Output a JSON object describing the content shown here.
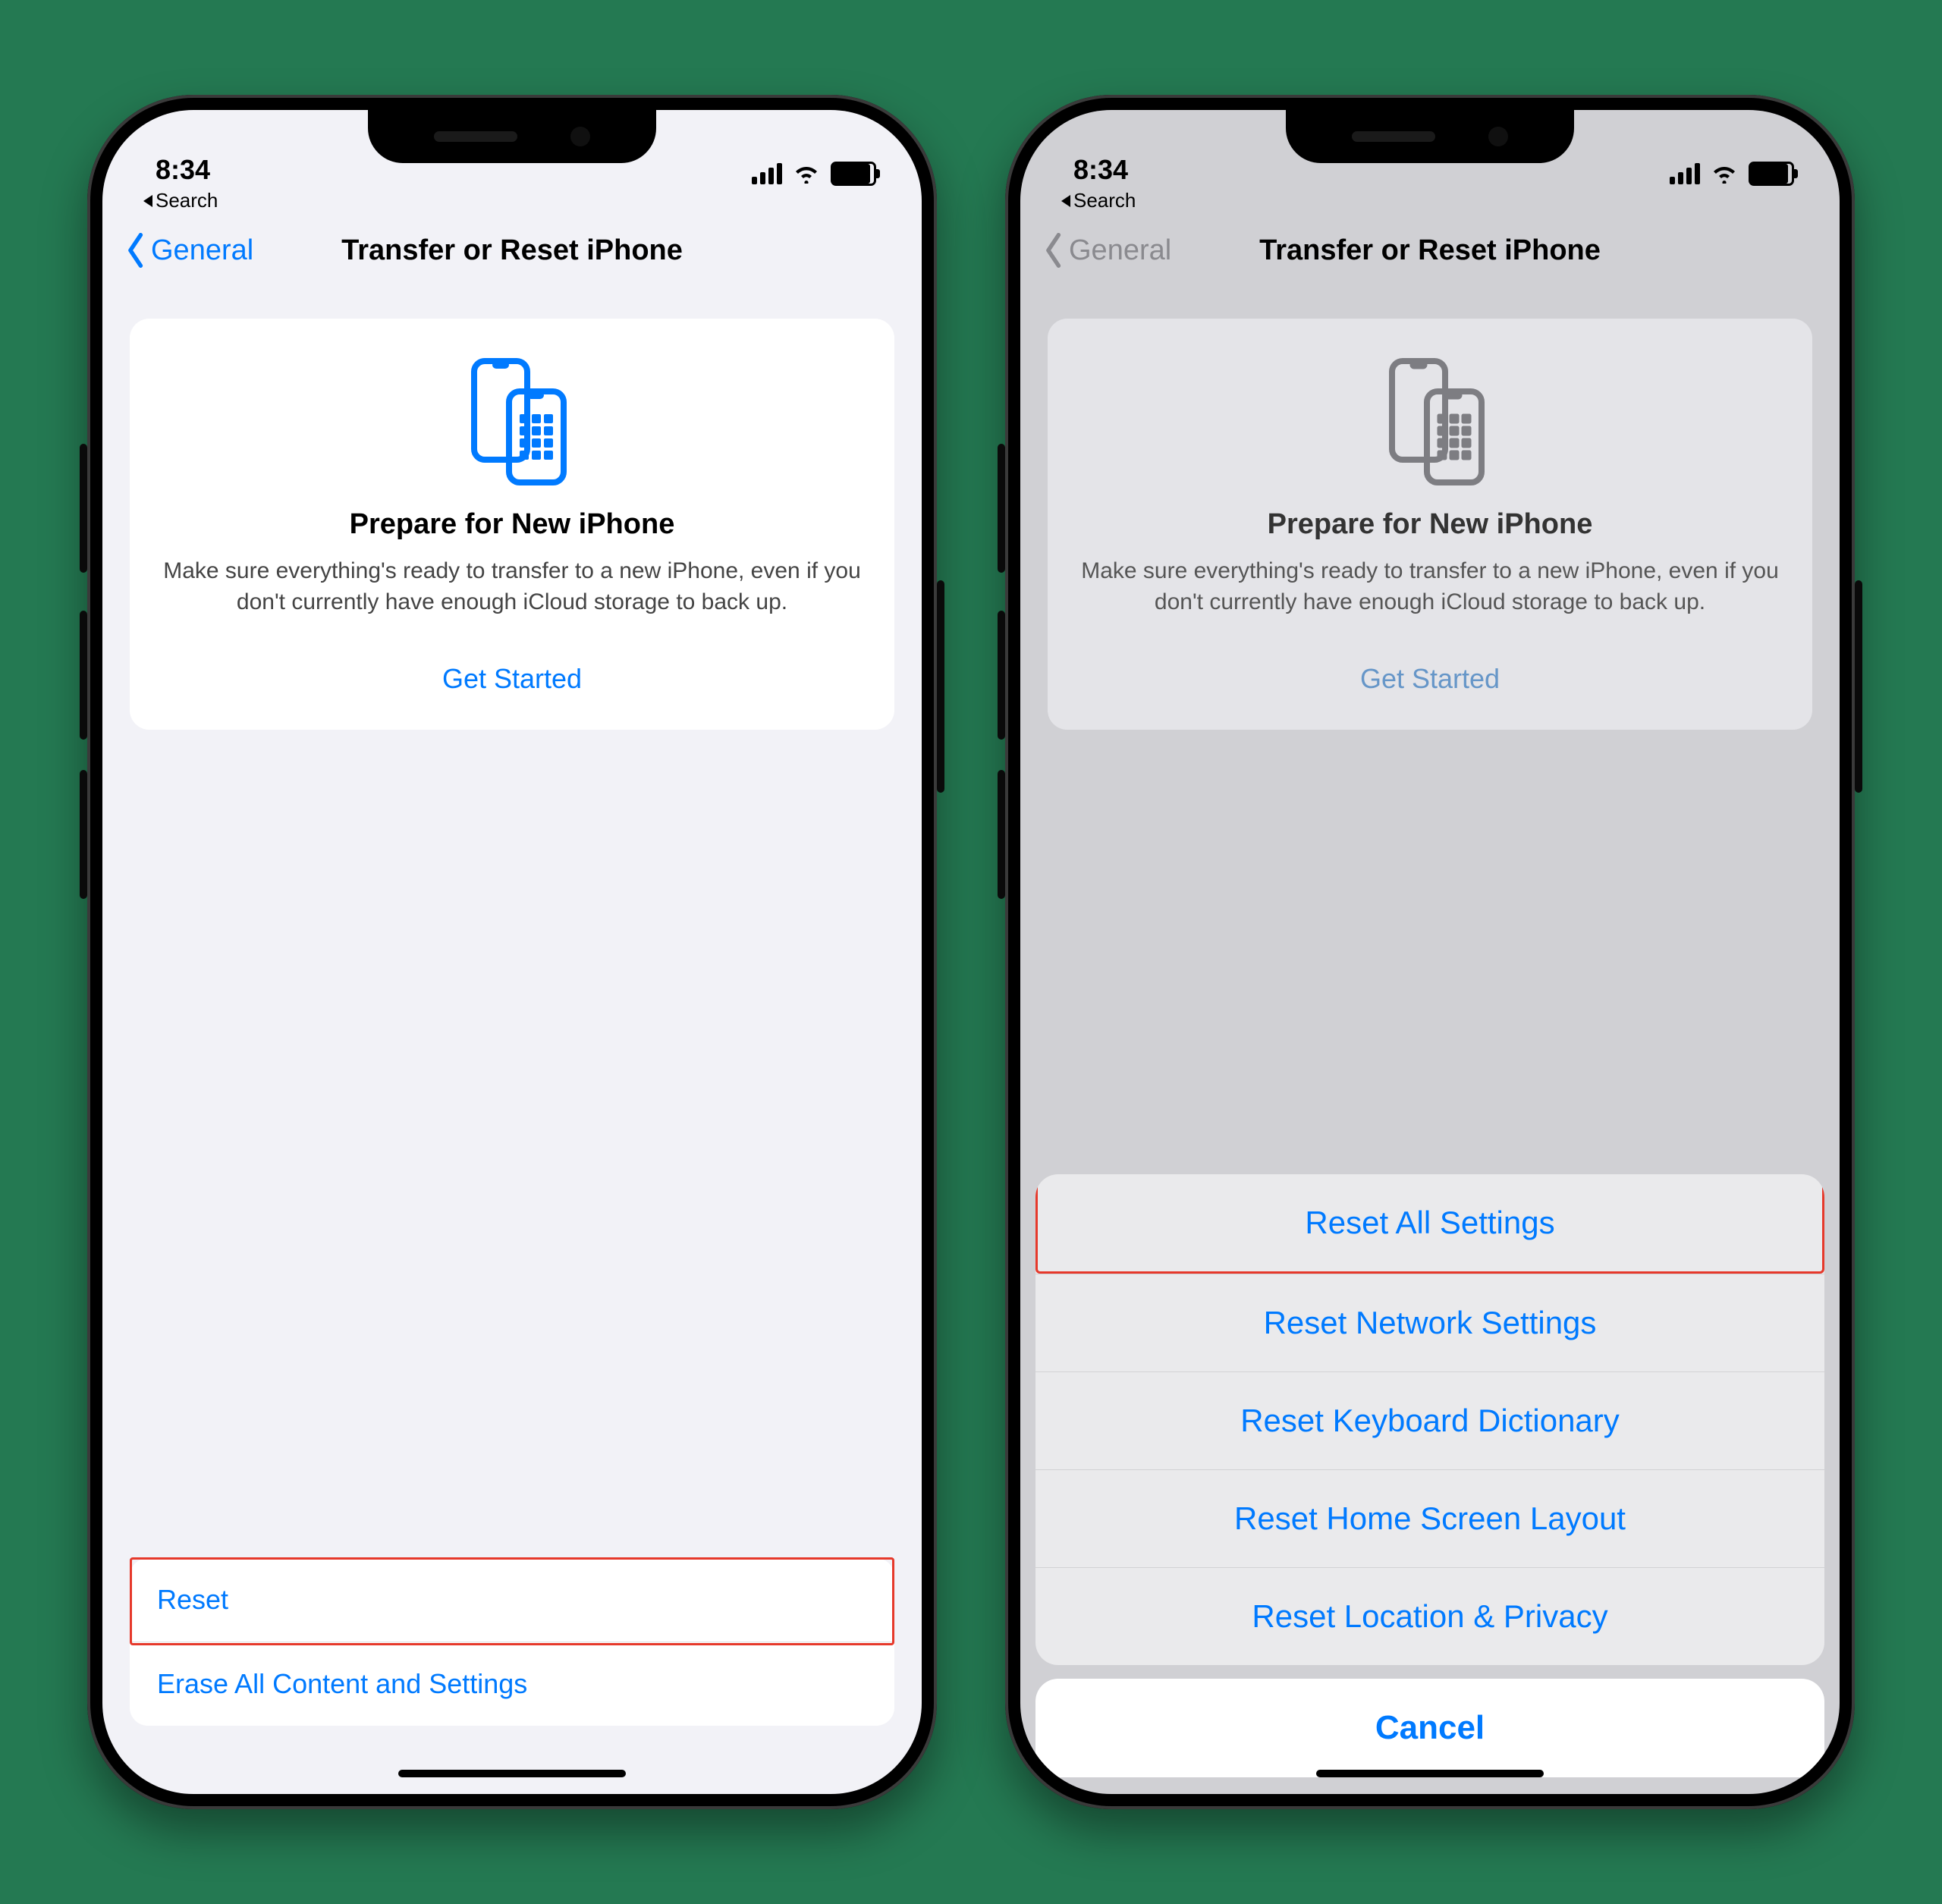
{
  "status": {
    "time": "8:34",
    "back_app": "Search"
  },
  "nav": {
    "back": "General",
    "title": "Transfer or Reset iPhone"
  },
  "card": {
    "heading": "Prepare for New iPhone",
    "body": "Make sure everything's ready to transfer to a new iPhone, even if you don't currently have enough iCloud storage to back up.",
    "cta": "Get Started"
  },
  "bottom": {
    "reset": "Reset",
    "erase": "Erase All Content and Settings"
  },
  "sheet": {
    "options": [
      "Reset All Settings",
      "Reset Network Settings",
      "Reset Keyboard Dictionary",
      "Reset Home Screen Layout",
      "Reset Location & Privacy"
    ],
    "cancel": "Cancel"
  }
}
